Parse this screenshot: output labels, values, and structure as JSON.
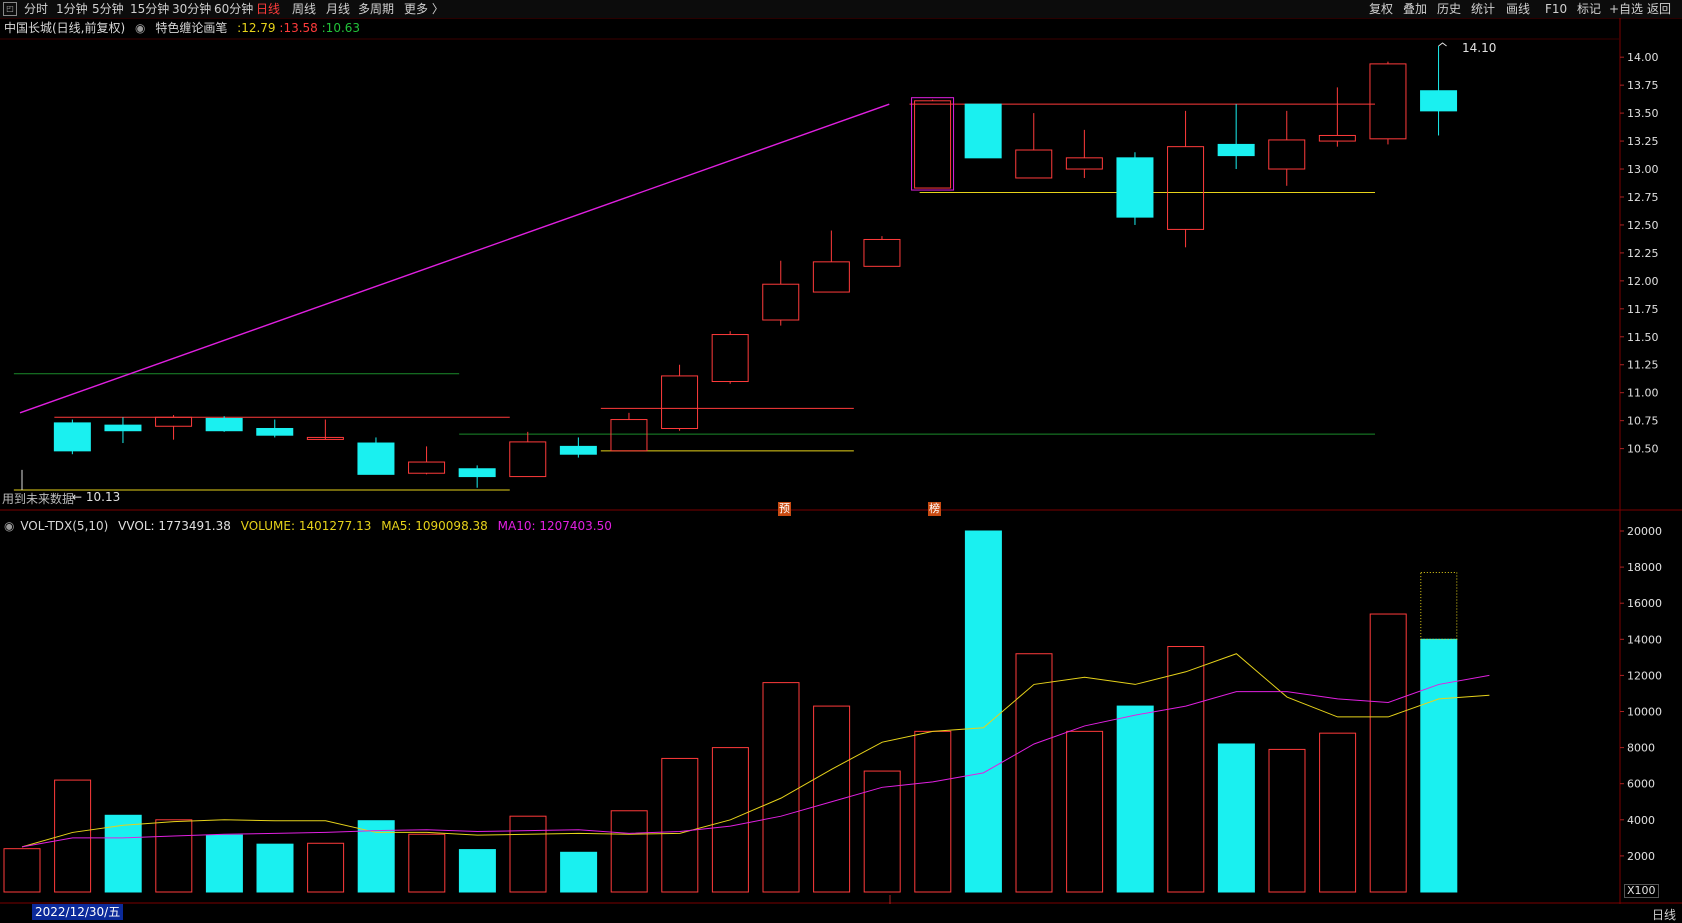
{
  "toolbar": {
    "tabs": [
      "分时",
      "1分钟",
      "5分钟",
      "15分钟",
      "30分钟",
      "60分钟",
      "日线",
      "周线",
      "月线",
      "多周期",
      "更多 〉"
    ],
    "active_tab": "日线",
    "right_items": [
      "复权",
      "叠加",
      "历史",
      "统计",
      "画线",
      "F10",
      "标记",
      "+自选",
      "返回"
    ]
  },
  "price_panel": {
    "stock_title": "中国长城(日线,前复权)",
    "indicator_name": "特色缠论画笔",
    "indicator_values": [
      ":12.79",
      ":13.58",
      ":10.63"
    ],
    "indicator_colors": [
      "#e6d21a",
      "#ff3b3b",
      "#22c33a"
    ],
    "future_data_note": "用到未来数据",
    "low_label": "← 10.13",
    "high_label": "14.10",
    "markers": [
      "预",
      "榜"
    ],
    "y_ticks": [
      "14.00",
      "13.75",
      "13.50",
      "13.25",
      "13.00",
      "12.75",
      "12.50",
      "12.25",
      "12.00",
      "11.75",
      "11.50",
      "11.25",
      "11.00",
      "10.75",
      "10.50"
    ]
  },
  "volume_panel": {
    "title": "VOL-TDX(5,10)",
    "vvol": "VVOL: 1773491.38",
    "volume": "VOLUME: 1401277.13",
    "ma5": "MA5: 1090098.38",
    "ma10": "MA10: 1207403.50",
    "colors": {
      "vvol": "#e0e0e0",
      "volume": "#e6d21a",
      "ma5": "#e6d21a",
      "ma10": "#e020e0"
    },
    "y_ticks": [
      "20000",
      "18000",
      "16000",
      "14000",
      "12000",
      "10000",
      "8000",
      "6000",
      "4000",
      "2000"
    ],
    "unit": "X100"
  },
  "bottom": {
    "date": "2022/12/30/五",
    "period": "日线"
  },
  "chart_data": {
    "type": "candlestick+bar",
    "price_range": [
      10.13,
      14.1
    ],
    "candles": [
      {
        "o": 10.73,
        "c": 10.48,
        "h": 10.76,
        "l": 10.45,
        "up": false
      },
      {
        "o": 10.71,
        "c": 10.66,
        "h": 10.78,
        "l": 10.55,
        "up": false
      },
      {
        "o": 10.7,
        "c": 10.78,
        "h": 10.8,
        "l": 10.58,
        "up": true
      },
      {
        "o": 10.77,
        "c": 10.66,
        "h": 10.79,
        "l": 10.65,
        "up": false
      },
      {
        "o": 10.68,
        "c": 10.62,
        "h": 10.76,
        "l": 10.6,
        "up": false
      },
      {
        "o": 10.6,
        "c": 10.6,
        "h": 10.76,
        "l": 10.58,
        "up": true
      },
      {
        "o": 10.55,
        "c": 10.27,
        "h": 10.6,
        "l": 10.27,
        "up": false
      },
      {
        "o": 10.28,
        "c": 10.38,
        "h": 10.52,
        "l": 10.27,
        "up": true
      },
      {
        "o": 10.32,
        "c": 10.25,
        "h": 10.35,
        "l": 10.15,
        "up": false
      },
      {
        "o": 10.25,
        "c": 10.56,
        "h": 10.65,
        "l": 10.25,
        "up": true
      },
      {
        "o": 10.52,
        "c": 10.45,
        "h": 10.6,
        "l": 10.42,
        "up": false
      },
      {
        "o": 10.48,
        "c": 10.76,
        "h": 10.82,
        "l": 10.48,
        "up": true
      },
      {
        "o": 10.68,
        "c": 11.15,
        "h": 11.25,
        "l": 10.66,
        "up": true
      },
      {
        "o": 11.1,
        "c": 11.52,
        "h": 11.55,
        "l": 11.08,
        "up": true
      },
      {
        "o": 11.65,
        "c": 11.97,
        "h": 12.18,
        "l": 11.6,
        "up": true
      },
      {
        "o": 11.9,
        "c": 12.17,
        "h": 12.45,
        "l": 11.9,
        "up": true
      },
      {
        "o": 12.13,
        "c": 12.37,
        "h": 12.4,
        "l": 12.13,
        "up": true
      },
      {
        "o": 12.83,
        "c": 13.61,
        "h": 13.62,
        "l": 12.83,
        "up": true
      },
      {
        "o": 13.58,
        "c": 13.1,
        "h": 13.58,
        "l": 13.1,
        "up": false
      },
      {
        "o": 12.92,
        "c": 13.17,
        "h": 13.5,
        "l": 12.92,
        "up": true
      },
      {
        "o": 13.0,
        "c": 13.1,
        "h": 13.35,
        "l": 12.92,
        "up": true
      },
      {
        "o": 13.1,
        "c": 12.57,
        "h": 13.15,
        "l": 12.5,
        "up": false
      },
      {
        "o": 12.46,
        "c": 13.2,
        "h": 13.52,
        "l": 12.3,
        "up": true
      },
      {
        "o": 13.22,
        "c": 13.12,
        "h": 13.58,
        "l": 13.0,
        "up": false
      },
      {
        "o": 13.0,
        "c": 13.26,
        "h": 13.52,
        "l": 12.85,
        "up": true
      },
      {
        "o": 13.25,
        "c": 13.3,
        "h": 13.73,
        "l": 13.2,
        "up": true
      },
      {
        "o": 13.27,
        "c": 13.94,
        "h": 13.96,
        "l": 13.22,
        "up": true
      },
      {
        "o": 13.7,
        "c": 13.52,
        "h": 14.1,
        "l": 13.3,
        "up": false
      }
    ],
    "volume_range": [
      0,
      20000
    ],
    "volumes": [
      2400,
      6200,
      4250,
      4000,
      3150,
      2650,
      2700,
      3950,
      3200,
      2350,
      4200,
      2200,
      4500,
      7400,
      8000,
      11600,
      10300,
      6700,
      8900,
      20000,
      13200,
      8900,
      10300,
      13600,
      8200,
      7900,
      8800,
      15400,
      14000
    ],
    "volume_up": [
      true,
      true,
      false,
      true,
      false,
      false,
      true,
      false,
      true,
      false,
      true,
      false,
      true,
      true,
      true,
      true,
      true,
      true,
      true,
      false,
      true,
      true,
      false,
      true,
      false,
      true,
      true,
      true,
      false
    ],
    "volume_ghost_top": 17700,
    "ma5": [
      2500,
      3300,
      3700,
      3900,
      4000,
      3950,
      3950,
      3300,
      3300,
      3150,
      3200,
      3250,
      3200,
      3250,
      4000,
      5200,
      6800,
      8300,
      8900,
      9100,
      11500,
      11900,
      11500,
      12200,
      13200,
      10800,
      9700,
      9700,
      10700,
      10900
    ],
    "ma10": [
      2500,
      3000,
      3000,
      3100,
      3200,
      3250,
      3300,
      3400,
      3450,
      3350,
      3400,
      3450,
      3250,
      3350,
      3650,
      4200,
      5000,
      5800,
      6100,
      6600,
      8200,
      9200,
      9800,
      10300,
      11100,
      11100,
      10700,
      10500,
      11500,
      12000
    ]
  }
}
